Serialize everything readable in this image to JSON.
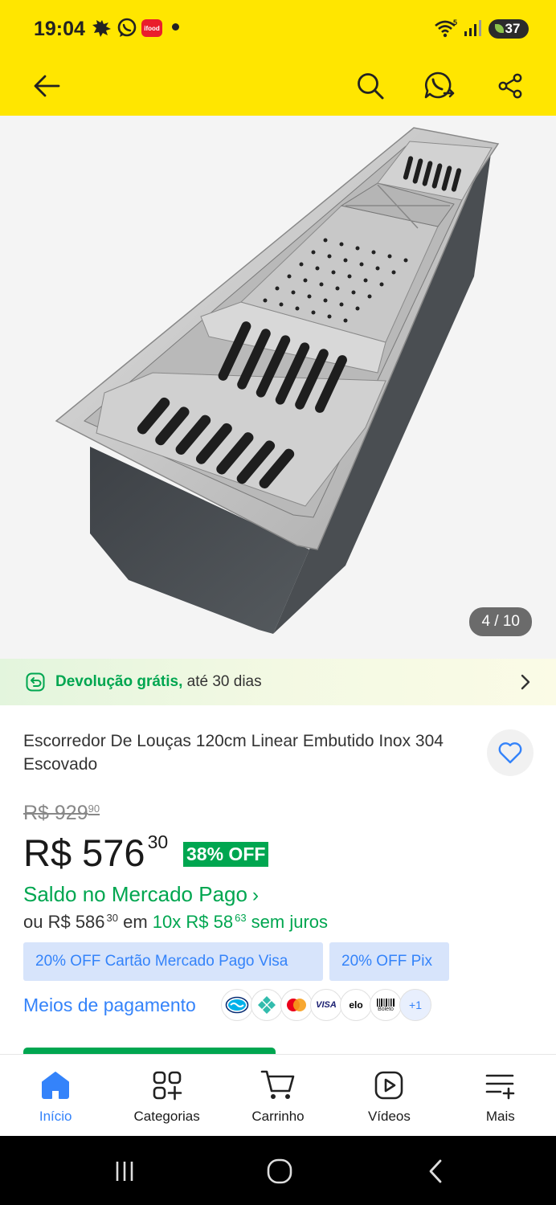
{
  "status_bar": {
    "time": "19:04",
    "icons": [
      "weather-icon",
      "whatsapp-icon",
      "ifood-icon",
      "notification-dot"
    ],
    "ifood_label": "ifood",
    "signal_icons": [
      "wifi-icon",
      "cell-signal-icon"
    ],
    "battery": "37"
  },
  "header": {
    "buttons": [
      "back-arrow-icon",
      "search-icon",
      "whatsapp-share-icon",
      "share-icon"
    ],
    "background_color": "#ffe600"
  },
  "gallery": {
    "counter": "4 / 10",
    "image_alt": "Escorredor de louças inox embutido"
  },
  "return_banner": {
    "bold": "Devolução grátis,",
    "text": " até 30 dias"
  },
  "product": {
    "title": "Escorredor De Louças 120cm Linear Embutido Inox 304 Escovado",
    "old_price_int": "R$ 929",
    "old_price_cents": "90",
    "price_int": "R$ 576",
    "price_cents": "30",
    "discount": "38% OFF",
    "saldo": "Saldo no Mercado Pago",
    "inst_prefix": "ou R$ 586",
    "inst_prefix_cents": "30",
    "inst_mid": " em ",
    "inst_green": "10x R$ 58",
    "inst_green_cents": "63",
    "inst_suffix": " sem juros"
  },
  "promos": [
    "20% OFF Cartão Mercado Pago Visa",
    "20% OFF Pix"
  ],
  "payment": {
    "link": "Meios de pagamento",
    "methods": [
      "mercado-pago-icon",
      "pix-icon",
      "mastercard-icon",
      "visa-icon",
      "elo-icon",
      "boleto-icon"
    ],
    "visa": "VISA",
    "elo": "elo",
    "boleto": "Boleto",
    "more": "+1"
  },
  "bottom_nav": [
    {
      "label": "Início",
      "icon": "home-icon",
      "active": true
    },
    {
      "label": "Categorias",
      "icon": "categories-icon"
    },
    {
      "label": "Carrinho",
      "icon": "cart-icon"
    },
    {
      "label": "Vídeos",
      "icon": "video-icon"
    },
    {
      "label": "Mais",
      "icon": "menu-icon"
    }
  ],
  "colors": {
    "accent_blue": "#3483fa",
    "green": "#00a650",
    "yellow": "#ffe600"
  }
}
